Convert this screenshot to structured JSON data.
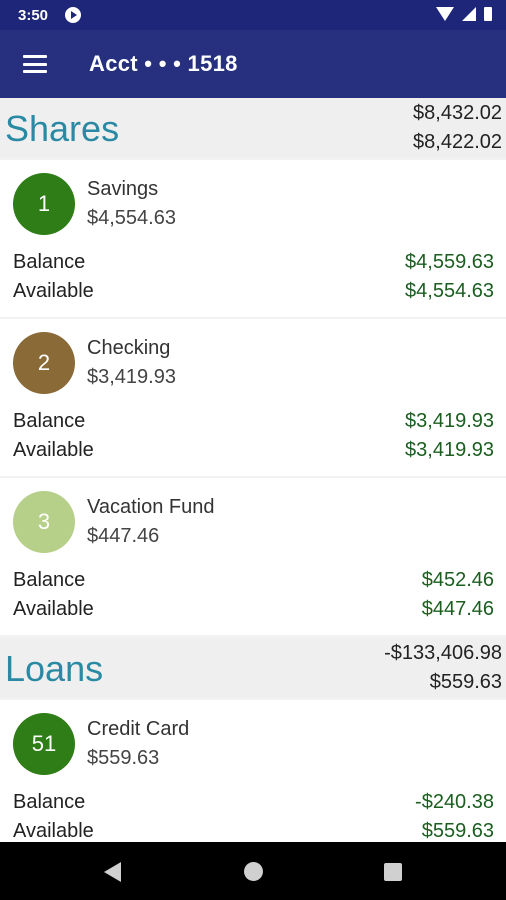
{
  "status_bar": {
    "time": "3:50"
  },
  "app_bar": {
    "title": "Acct • • • 1518"
  },
  "shares": {
    "title": "Shares",
    "total_balance": "$8,432.02",
    "total_available": "$8,422.02",
    "accounts": [
      {
        "number": "1",
        "name": "Savings",
        "amount": "$4,554.63",
        "balance_label": "Balance",
        "balance": "$4,559.63",
        "available_label": "Available",
        "available": "$4,554.63",
        "color": "#2e7d16"
      },
      {
        "number": "2",
        "name": "Checking",
        "amount": "$3,419.93",
        "balance_label": "Balance",
        "balance": "$3,419.93",
        "available_label": "Available",
        "available": "$3,419.93",
        "color": "#8a6a37"
      },
      {
        "number": "3",
        "name": "Vacation Fund",
        "amount": "$447.46",
        "balance_label": "Balance",
        "balance": "$452.46",
        "available_label": "Available",
        "available": "$447.46",
        "color": "#b6d08a"
      }
    ]
  },
  "loans": {
    "title": "Loans",
    "total_balance": "-$133,406.98",
    "total_available": "$559.63",
    "accounts": [
      {
        "number": "51",
        "name": "Credit Card",
        "amount": "$559.63",
        "balance_label": "Balance",
        "balance": "-$240.38",
        "available_label": "Available",
        "available": "$559.63",
        "color": "#2e7d16"
      }
    ]
  },
  "icons": {
    "status": [
      "app-notification-icon",
      "wifi-icon",
      "signal-icon",
      "battery-icon"
    ],
    "app_bar": [
      "menu-icon"
    ],
    "nav": [
      "back-icon",
      "home-icon",
      "recents-icon"
    ]
  }
}
